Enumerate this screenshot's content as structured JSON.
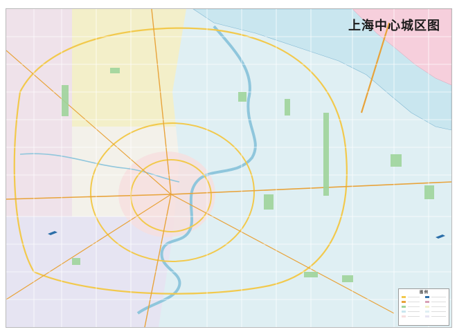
{
  "map": {
    "title": "上海中心城区图",
    "legend_title": "图 例",
    "colors": {
      "river": "#c9e6ef",
      "river_edge": "#7fb7d3",
      "east_district": "#dfeff3",
      "northwest_district": "#f3efc9",
      "west_district": "#efe2ea",
      "southwest_district": "#e6e4f2",
      "center": "#f6dede",
      "north_bank": "#f6cfdc",
      "park": "#9fd49b",
      "ring_road": "#f2c94c",
      "main_road": "#ffffff",
      "highway": "#e8a33a"
    }
  }
}
